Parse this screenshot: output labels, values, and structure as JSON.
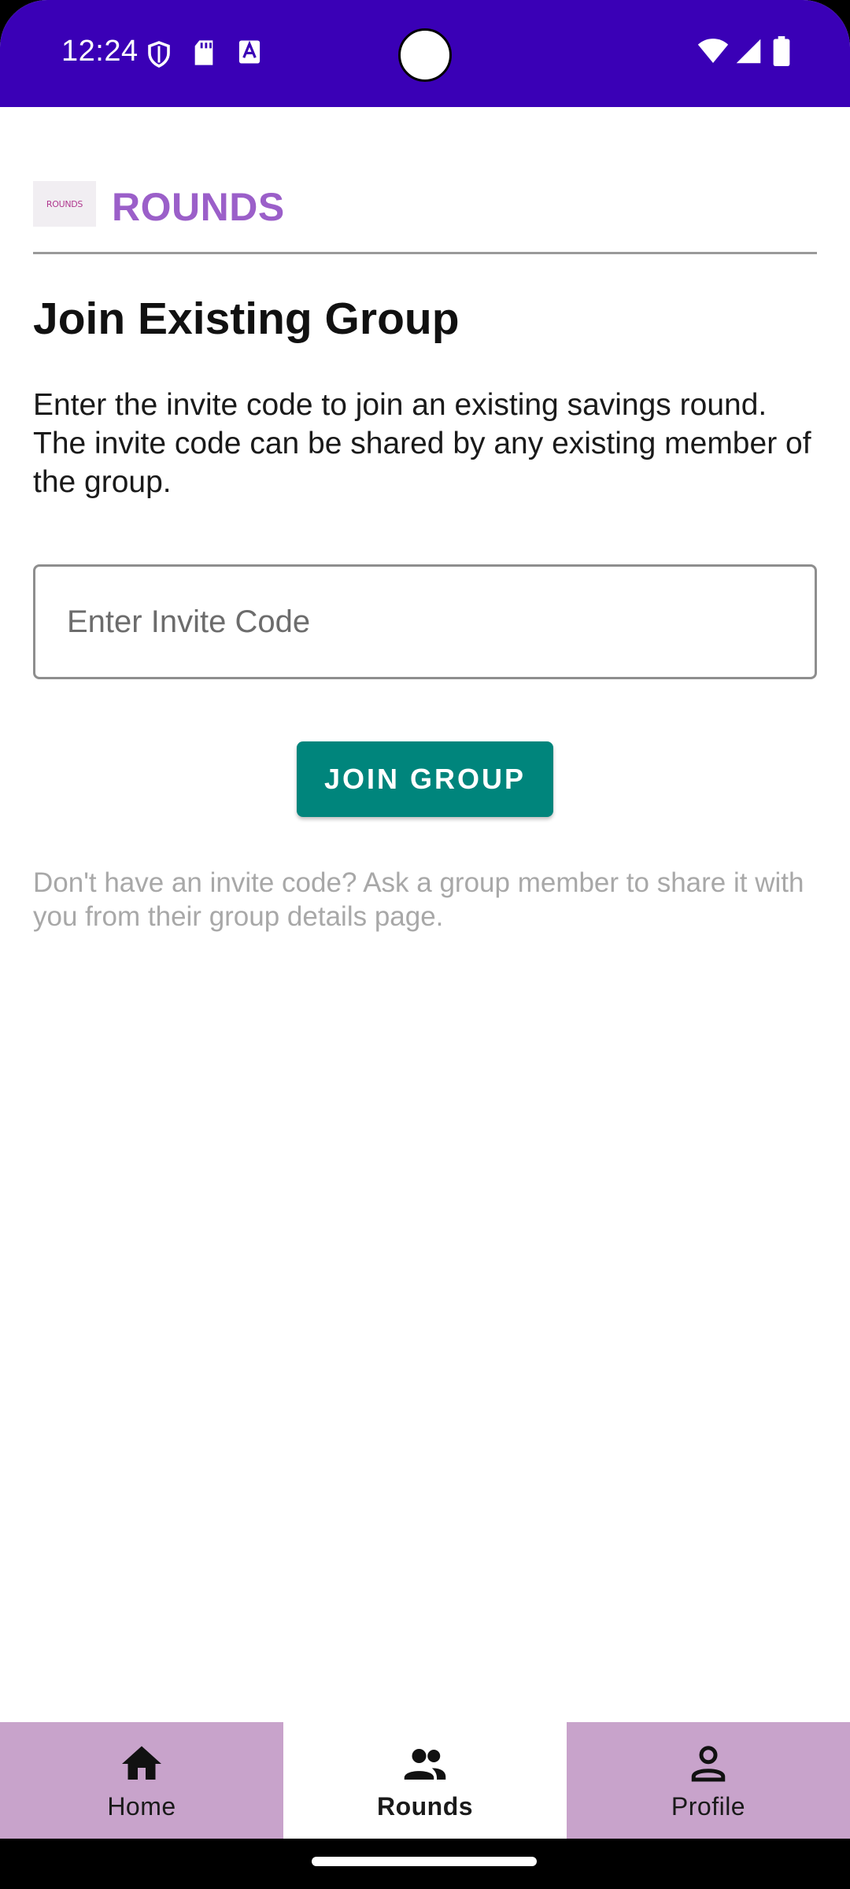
{
  "status_bar": {
    "time": "12:24",
    "icons_left": [
      "shield-icon",
      "sd-card-icon",
      "text-a-icon"
    ],
    "icons_right": [
      "wifi-icon",
      "cell-signal-icon",
      "battery-icon"
    ],
    "bg_color": "#3a00b6"
  },
  "header": {
    "logo_text": "ROUNDS",
    "brand": "ROUNDS",
    "brand_color": "#9b5fc9"
  },
  "main": {
    "title": "Join Existing Group",
    "description": "Enter the invite code to join an existing savings round. The invite code can be shared by any existing member of the group.",
    "invite_input": {
      "placeholder": "Enter Invite Code",
      "value": ""
    },
    "join_button_label": "JOIN GROUP",
    "join_button_color": "#00857c",
    "hint": "Don't have an invite code? Ask a group member to share it with you from their group details page."
  },
  "bottom_nav": {
    "items": [
      {
        "label": "Home",
        "icon": "home-icon",
        "active": false
      },
      {
        "label": "Rounds",
        "icon": "group-icon",
        "active": true
      },
      {
        "label": "Profile",
        "icon": "person-icon",
        "active": false
      }
    ],
    "inactive_color": "#c8a3cb"
  }
}
